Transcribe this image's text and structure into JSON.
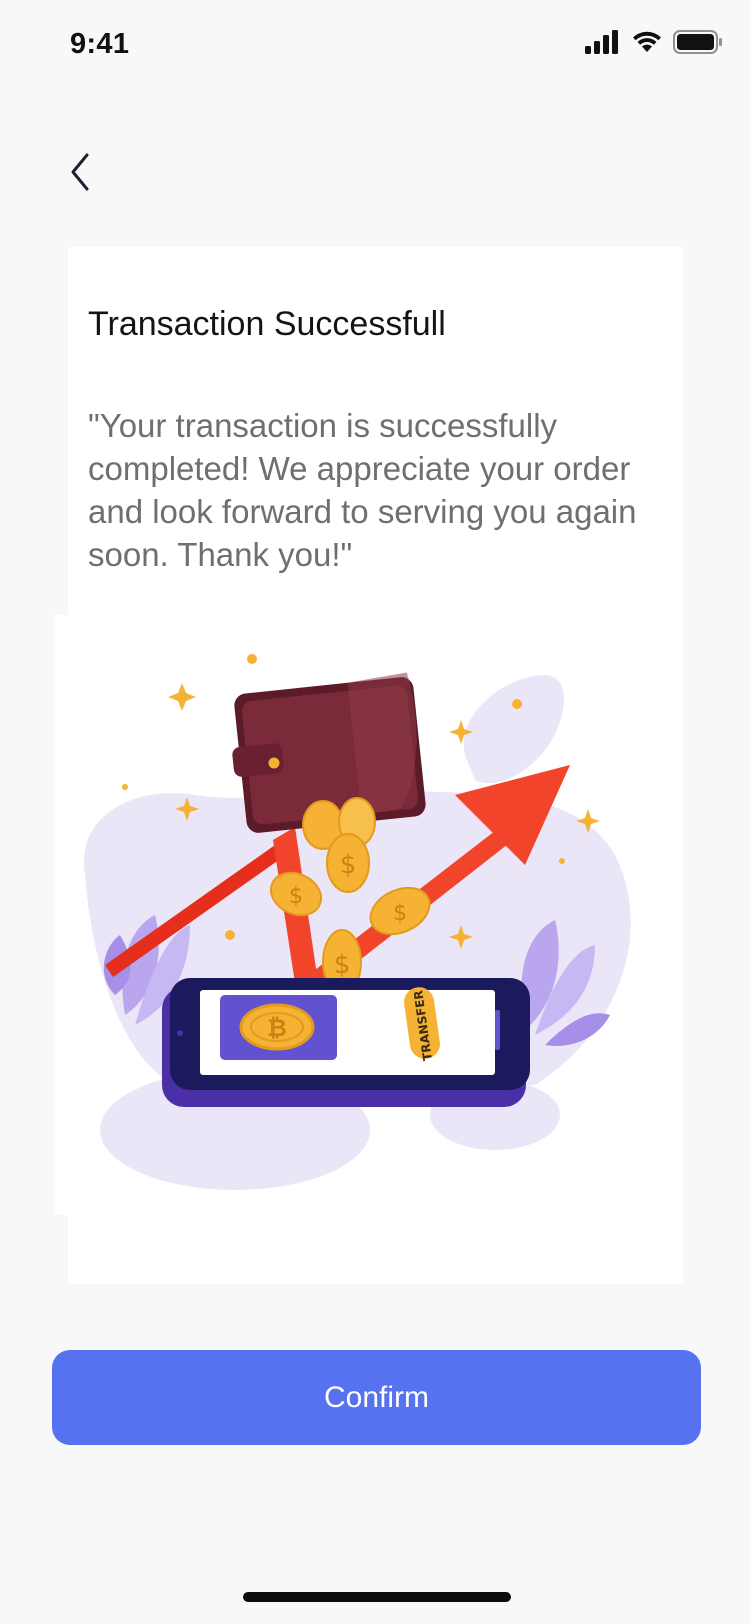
{
  "status_bar": {
    "time": "9:41"
  },
  "card": {
    "title": "Transaction Successfull",
    "message": "\"Your transaction is successfully completed! We appreciate your order and look forward to serving you again soon. Thank you!\""
  },
  "illustration": {
    "transfer_label": "TRANSFER",
    "icons": [
      "wallet-icon",
      "coin-icon",
      "bitcoin-icon",
      "arrow-up-icon",
      "sparkle-icon",
      "phone-icon"
    ]
  },
  "actions": {
    "confirm_label": "Confirm"
  },
  "colors": {
    "accent": "#5672f0",
    "background": "#f8f8f8",
    "card": "#ffffff",
    "title": "#141414",
    "body_text": "#6f6f6f",
    "arrow": "#f2442b",
    "coin": "#f5b233",
    "wallet": "#6b2230",
    "phone": "#4b2fa6"
  }
}
